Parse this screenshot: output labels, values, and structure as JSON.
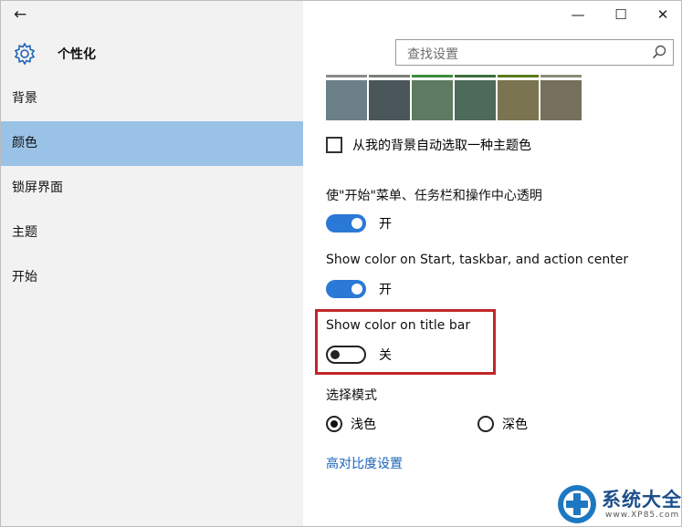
{
  "window": {
    "back_glyph": "←",
    "minimize_glyph": "—",
    "maximize_glyph": "☐",
    "close_glyph": "✕"
  },
  "app": {
    "title": "个性化",
    "icon": "gear-icon"
  },
  "search": {
    "placeholder": "查找设置",
    "icon": "search-icon"
  },
  "nav": {
    "items": [
      {
        "label": "背景",
        "active": false
      },
      {
        "label": "颜色",
        "active": true
      },
      {
        "label": "锁屏界面",
        "active": false
      },
      {
        "label": "主题",
        "active": false
      },
      {
        "label": "开始",
        "active": false
      }
    ]
  },
  "colors": {
    "swatches": [
      "#6b8086",
      "#4b565b",
      "#5e7a61",
      "#4e6a5a",
      "#7b7450",
      "#766f5c"
    ],
    "swatch_edges": [
      "#8a8a8a",
      "#7a8079",
      "#3d8a3d",
      "#3f6f3a",
      "#5a7a1e",
      "#8a8a7a"
    ],
    "accent": "#2a79d6",
    "highlight_border": "#c0262b",
    "link": "#1a63b8"
  },
  "auto_accent": {
    "label": "从我的背景自动选取一种主题色",
    "checked": false
  },
  "transparency": {
    "label": "使\"开始\"菜单、任务栏和操作中心透明",
    "state_label": "开",
    "on": true
  },
  "show_color_start": {
    "label": "Show color on Start, taskbar, and action center",
    "state_label": "开",
    "on": true
  },
  "show_color_titlebar": {
    "label": "Show color on title bar",
    "state_label": "关",
    "on": false
  },
  "mode": {
    "label": "选择模式",
    "options": [
      {
        "label": "浅色",
        "selected": true
      },
      {
        "label": "深色",
        "selected": false
      }
    ]
  },
  "high_contrast_link": "高对比度设置",
  "watermark": {
    "title": "系统大全",
    "subtitle": "www.XP85.com"
  }
}
